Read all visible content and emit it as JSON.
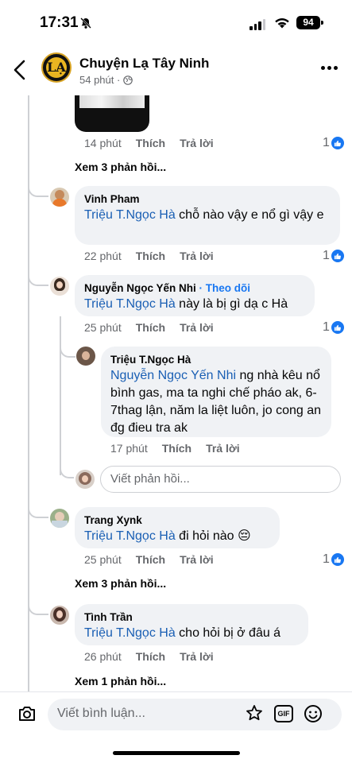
{
  "status_bar": {
    "time": "17:31",
    "battery": "94"
  },
  "header": {
    "page_name": "Chuyện Lạ Tây Ninh",
    "meta": "54 phút ·",
    "logo_text": "LẠ"
  },
  "comment_0": {
    "time": "14 phút",
    "like": "Thích",
    "reply": "Trả lời",
    "reactions": "1",
    "view_replies": "Xem 3 phản hồi..."
  },
  "comment_1": {
    "author": "Vinh Pham",
    "mention": "Triệu T.Ngọc Hà",
    "text": " chỗ nào vậy e nổ gì vậy e",
    "time": "22 phút",
    "like": "Thích",
    "reply": "Trả lời",
    "reactions": "1"
  },
  "comment_2": {
    "author": "Nguyễn Ngọc Yến Nhi",
    "follow": "· Theo dõi",
    "mention": "Triệu T.Ngọc Hà",
    "text": " này là bị gì dạ c Hà",
    "time": "25 phút",
    "like": "Thích",
    "reply": "Trả lời",
    "reactions": "1"
  },
  "reply_2_1": {
    "author": "Triệu T.Ngọc Hà",
    "mention": "Nguyễn Ngọc Yến Nhi",
    "text": " ng nhà kêu nổ bình gas, ma ta nghi chế pháo ak, 6-7thag lận, năm la liệt luôn, jo cong an đg đieu tra ak",
    "time": "17 phút",
    "like": "Thích",
    "reply": "Trả lời"
  },
  "reply_input": {
    "placeholder": "Viết phản hồi..."
  },
  "comment_3": {
    "author": "Trang Xynk",
    "mention": "Triệu T.Ngọc Hà",
    "text": " đi hỏi nào 😔",
    "time": "25 phút",
    "like": "Thích",
    "reply": "Trả lời",
    "reactions": "1",
    "view_replies": "Xem 3 phản hồi..."
  },
  "comment_4": {
    "author": "Tình Trần",
    "mention": "Triệu T.Ngọc Hà",
    "text": " cho hỏi bị ở đâu á",
    "time": "26 phút",
    "like": "Thích",
    "reply": "Trả lời",
    "view_replies": "Xem 1 phản hồi..."
  },
  "composer": {
    "placeholder": "Viết bình luận...",
    "gif_label": "GIF"
  },
  "icons": [
    "bell-slash-icon",
    "signal-icon",
    "wifi-icon",
    "back-icon",
    "globe-icon",
    "more-icon",
    "like-icon",
    "camera-icon",
    "sticker-icon",
    "gif-icon",
    "emoji-icon"
  ],
  "colors": {
    "accent": "#1877f2",
    "mention": "#1a5fb4",
    "bubble": "#f0f2f5",
    "muted": "#65676b"
  }
}
